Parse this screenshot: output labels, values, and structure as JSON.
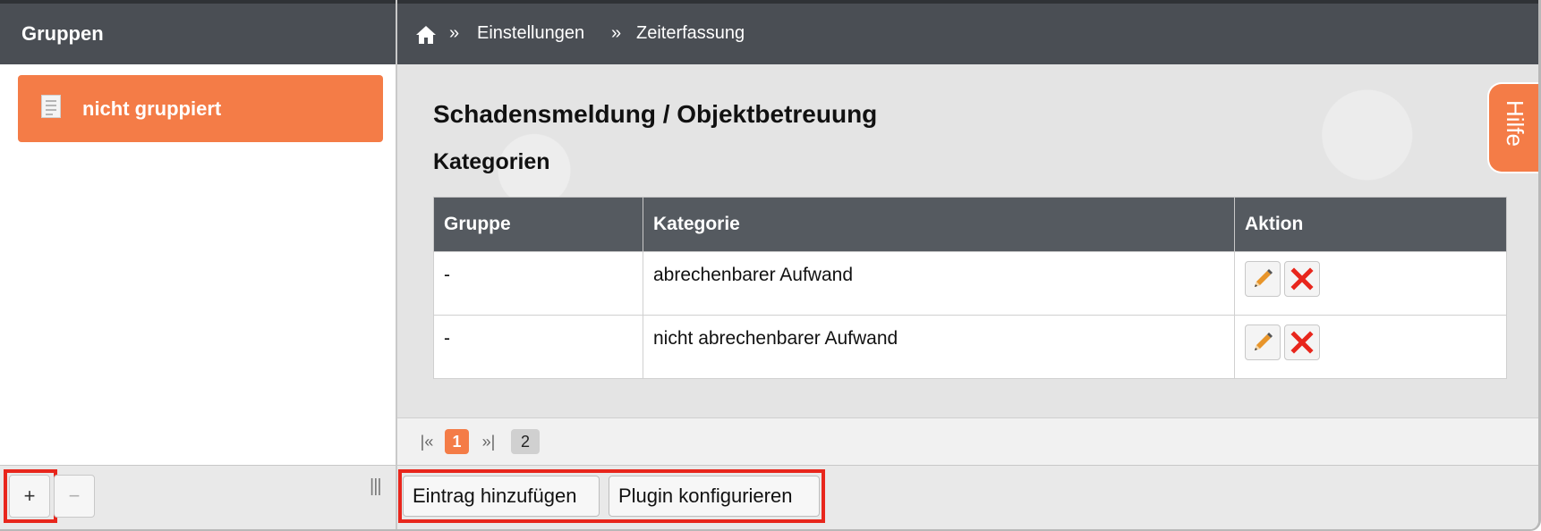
{
  "sidebar": {
    "title": "Gruppen",
    "groups": [
      {
        "label": "nicht gruppiert",
        "icon": "document-icon"
      }
    ],
    "add_label": "+",
    "remove_label": "−",
    "resize_label": "|||"
  },
  "breadcrumb": {
    "home_icon": "home-icon",
    "separator": "»",
    "items": [
      "Einstellungen",
      "Zeiterfassung"
    ]
  },
  "main": {
    "title": "Schadensmeldung / Objektbetreuung",
    "subtitle": "Kategorien",
    "table": {
      "columns": [
        "Gruppe",
        "Kategorie",
        "Aktion"
      ],
      "rows": [
        {
          "gruppe": "-",
          "kategorie": "abrechenbarer Aufwand",
          "actions": [
            "edit-icon",
            "delete-icon"
          ]
        },
        {
          "gruppe": "-",
          "kategorie": "nicht abrechenbarer Aufwand",
          "actions": [
            "edit-icon",
            "delete-icon"
          ]
        }
      ]
    }
  },
  "help": {
    "label": "Hilfe"
  },
  "pagination": {
    "first_label": "|«",
    "current_page": "1",
    "last_label": "»|",
    "total_pages": "2"
  },
  "toolbar": {
    "add_entry_label": "Eintrag hinzufügen",
    "configure_plugin_label": "Plugin konfigurieren"
  },
  "colors": {
    "accent": "#f47c47",
    "header_bg": "#4a4e54",
    "table_header_bg": "#555a60",
    "highlight": "#e8261c",
    "delete_red": "#e8261c"
  }
}
